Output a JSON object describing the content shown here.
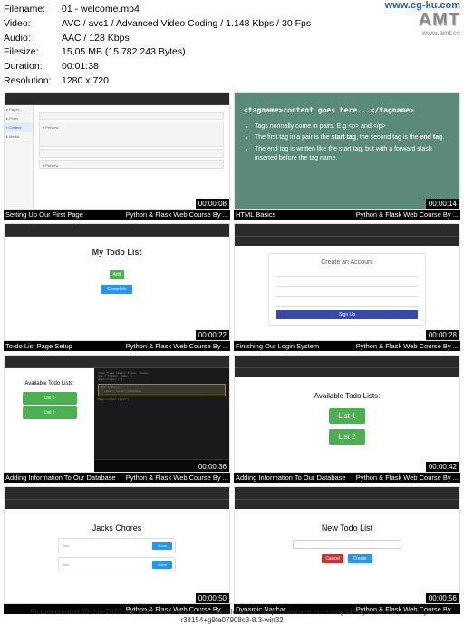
{
  "metadata": {
    "filename_label": "Filename:",
    "filename": "01 - welcome.mp4",
    "video_label": "Video:",
    "video": "AVC / avc1 / Advanced Video Coding / 1.148 Kbps / 30 Fps",
    "audio_label": "Audio:",
    "audio": "AAC / 128 Kbps",
    "filesize_label": "Filesize:",
    "filesize": "15,05 MB (15.782.243 Bytes)",
    "duration_label": "Duration:",
    "duration": "00:01:38",
    "resolution_label": "Resolution:",
    "resolution": "1280 x 720"
  },
  "logo": {
    "url": "www.cg-ku.com",
    "brand": "AMT",
    "sub": "www.amt.cc"
  },
  "course_credit": "Python & Flask Web Course By ...",
  "thumbs": [
    {
      "caption": "Setting Up Our First Page",
      "time": "00:00:08"
    },
    {
      "caption": "HTML Basics",
      "time": "00:00:14"
    },
    {
      "caption": "To-do List Page Setup",
      "time": "00:00:22"
    },
    {
      "caption": "Finishing Our Login System",
      "time": "00:00:28"
    },
    {
      "caption": "Adding Information To Our Database",
      "time": "00:00:36"
    },
    {
      "caption": "Adding Information To Our Database",
      "time": "00:00:42"
    },
    {
      "caption": "",
      "time": "00:00:50"
    },
    {
      "caption": "Dynamic Navbar",
      "time": "00:00:56"
    }
  ],
  "slide": {
    "tag_example": "<tagname>content goes here...</tagname>",
    "bullets": [
      "Tags normally come in pairs. E.g <p> and </p>",
      "The first tag in a pair is the start tag, the second tag is the end tag.",
      "The end tag is written like the start tag, but with a forward slash inserted before the tag name."
    ]
  },
  "todo": {
    "title": "My Todo List",
    "btn_add": "Add",
    "btn_complete": "Complete"
  },
  "account": {
    "title": "Create an Account",
    "btn": "Sign Up"
  },
  "available": {
    "title": "Available Todo Lists:",
    "lists": [
      "List 1",
      "List 2"
    ]
  },
  "jacks": {
    "title": "Jacks Chores"
  },
  "newlist": {
    "title": "New Todo List",
    "btn_create": "Create",
    "btn_cancel": "Cancel"
  },
  "footer": "Picture created 20-Jun-2020 with AMT - Auto-Movie-Thumbnailer - v12 - http://www.amt.cc - using MPlayer Version - sherpya-r38154+g9fe07908c3-8.3-win32"
}
